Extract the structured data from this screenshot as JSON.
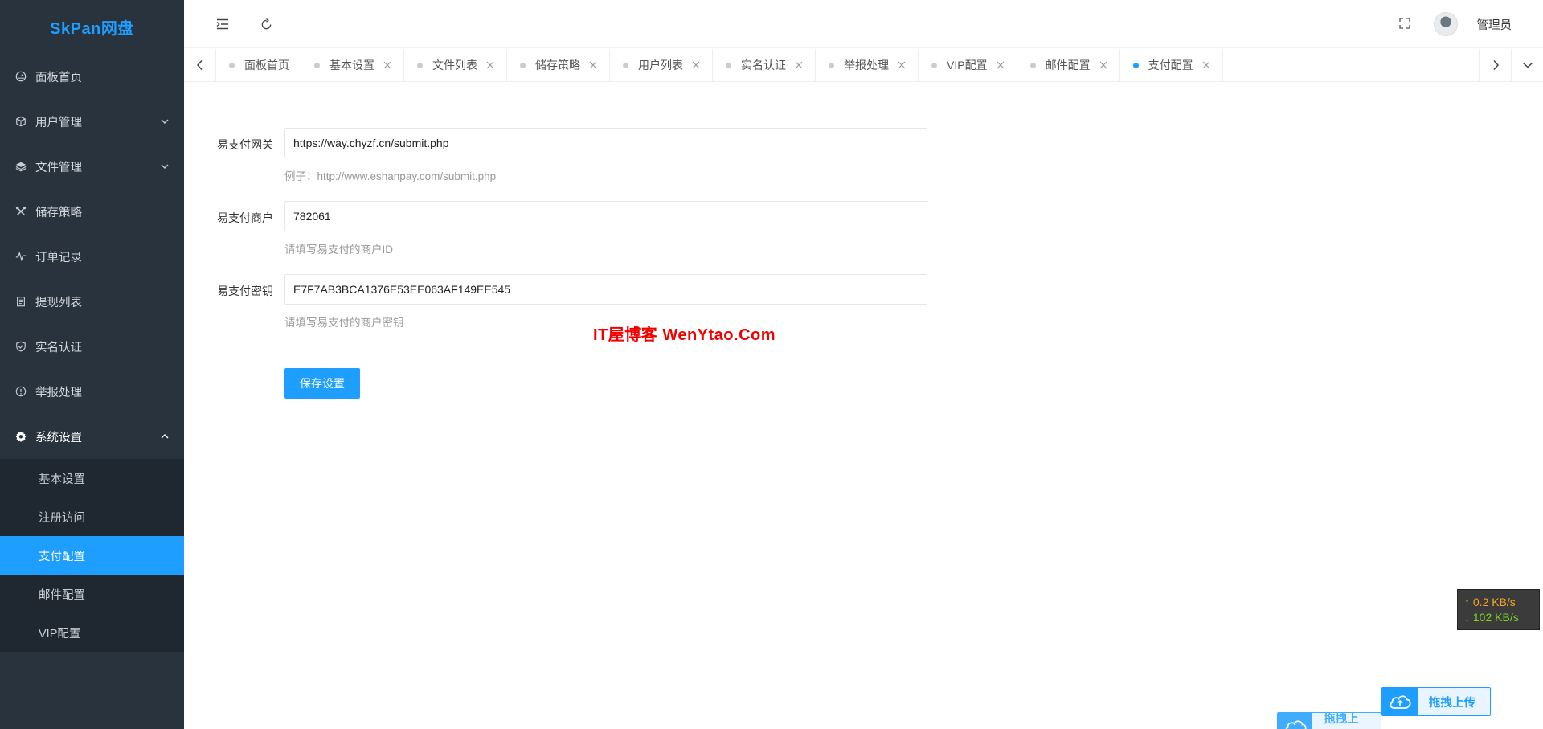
{
  "app": {
    "title": "SkPan网盘",
    "accent": "#1e9fff",
    "sidebar_bg": "#28333e"
  },
  "sidebar": {
    "items": [
      {
        "label": "面板首页",
        "icon": "dashboard-icon"
      },
      {
        "label": "用户管理",
        "icon": "cube-icon",
        "has_children": true
      },
      {
        "label": "文件管理",
        "icon": "layers-icon",
        "has_children": true
      },
      {
        "label": "储存策略",
        "icon": "tools-icon"
      },
      {
        "label": "订单记录",
        "icon": "pulse-icon"
      },
      {
        "label": "提现列表",
        "icon": "clipboard-icon"
      },
      {
        "label": "实名认证",
        "icon": "shield-check-icon"
      },
      {
        "label": "举报处理",
        "icon": "info-circle-icon"
      },
      {
        "label": "系统设置",
        "icon": "gear-icon",
        "has_children": true,
        "open": true
      }
    ],
    "submenu": [
      {
        "label": "基本设置"
      },
      {
        "label": "注册访问"
      },
      {
        "label": "支付配置",
        "active": true
      },
      {
        "label": "邮件配置"
      },
      {
        "label": "VIP配置"
      }
    ]
  },
  "header": {
    "user": "管理员"
  },
  "tabs": [
    {
      "label": "面板首页",
      "closable": false
    },
    {
      "label": "基本设置",
      "closable": true
    },
    {
      "label": "文件列表",
      "closable": true
    },
    {
      "label": "储存策略",
      "closable": true
    },
    {
      "label": "用户列表",
      "closable": true
    },
    {
      "label": "实名认证",
      "closable": true
    },
    {
      "label": "举报处理",
      "closable": true
    },
    {
      "label": "VIP配置",
      "closable": true
    },
    {
      "label": "邮件配置",
      "closable": true
    },
    {
      "label": "支付配置",
      "closable": true,
      "active": true
    }
  ],
  "form": {
    "gateway": {
      "label": "易支付网关",
      "value": "https://way.chyzf.cn/submit.php",
      "tip": "例子：http://www.eshanpay.com/submit.php"
    },
    "merchant": {
      "label": "易支付商户",
      "value": "782061",
      "tip": "请填写易支付的商户ID"
    },
    "secret": {
      "label": "易支付密钥",
      "value": "E7F7AB3BCA1376E53EE063AF149EE545",
      "tip": "请填写易支付的商户密钥"
    },
    "save_label": "保存设置"
  },
  "watermark": "IT屋博客  WenYtao.Com",
  "speed": {
    "up": "0.2 KB/s",
    "down": "102 KB/s"
  },
  "upload": {
    "label": "拖拽上传"
  }
}
